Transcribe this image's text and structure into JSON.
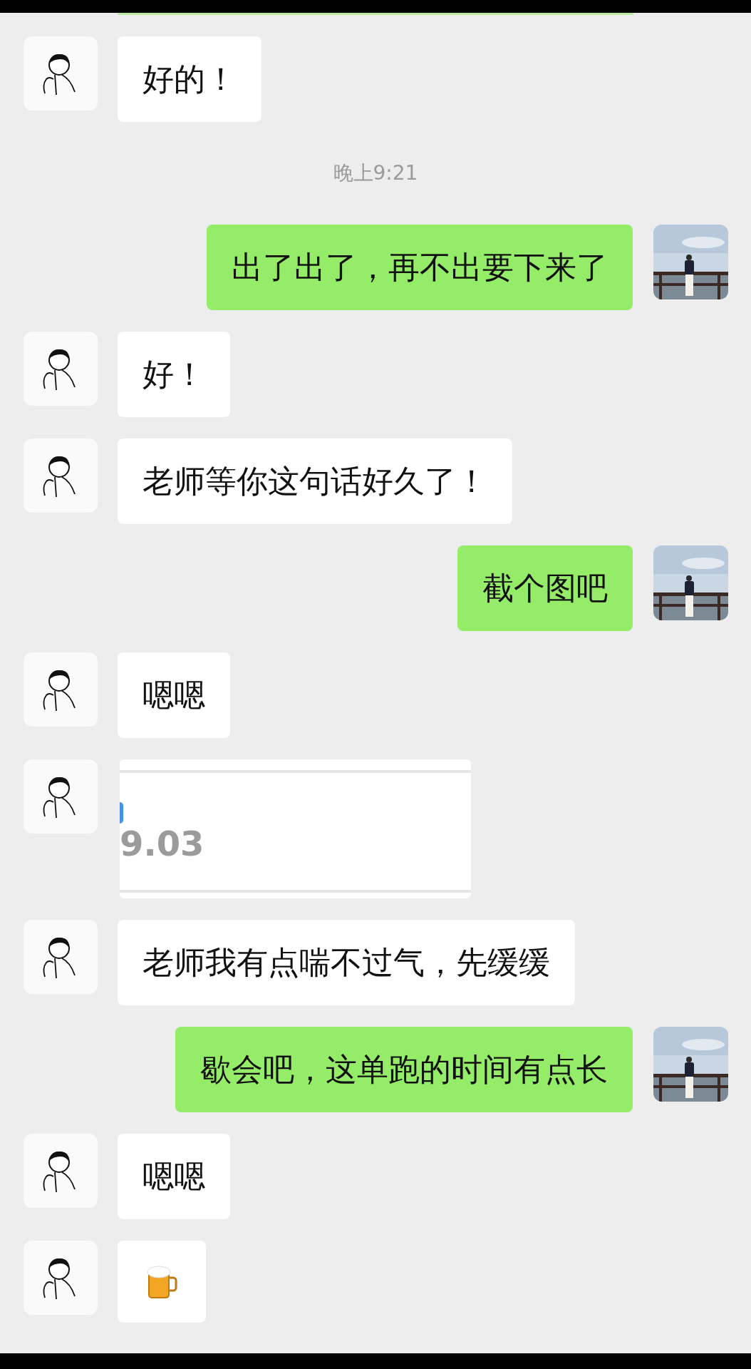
{
  "messages": [
    {
      "kind": "text",
      "outgoing": false,
      "text": "好的！"
    },
    {
      "kind": "time",
      "text": "晚上9:21"
    },
    {
      "kind": "text",
      "outgoing": true,
      "text": "出了出了，再不出要下来了"
    },
    {
      "kind": "text",
      "outgoing": false,
      "text": "好！"
    },
    {
      "kind": "text",
      "outgoing": false,
      "text": "老师等你这句话好久了！"
    },
    {
      "kind": "text",
      "outgoing": true,
      "text": "截个图吧"
    },
    {
      "kind": "text",
      "outgoing": false,
      "text": "嗯嗯"
    },
    {
      "outgoing": false,
      "text": "9.03"
    },
    {
      "kind": "text",
      "outgoing": false,
      "text": "老师我有点喘不过气，先缓缓"
    },
    {
      "kind": "text",
      "outgoing": true,
      "text": "歇会吧，这单跑的时间有点长"
    },
    {
      "kind": "text",
      "outgoing": false,
      "text": "嗯嗯"
    },
    {
      "kind": "sticker",
      "outgoing": false
    }
  ]
}
